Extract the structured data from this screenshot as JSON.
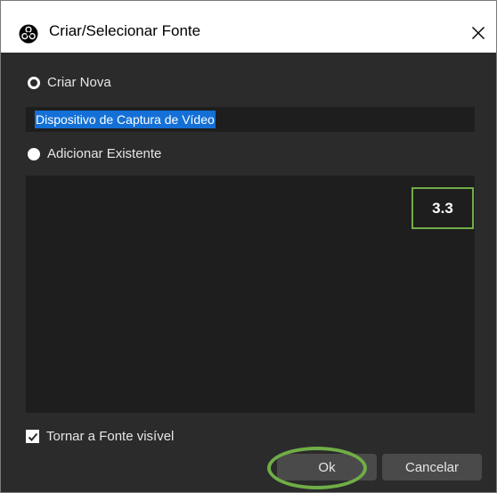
{
  "dialog": {
    "title": "Criar/Selecionar Fonte",
    "close_icon": "close-icon"
  },
  "create_new": {
    "label": "Criar Nova",
    "selected": true,
    "name_value": "Dispositivo de Captura de Vídeo"
  },
  "add_existing": {
    "label": "Adicionar Existente",
    "selected": false
  },
  "annotation": {
    "label": "3.3",
    "color": "#70ad47"
  },
  "visible_checkbox": {
    "label": "Tornar a Fonte visível",
    "checked": true
  },
  "buttons": {
    "ok": "Ok",
    "cancel": "Cancelar"
  },
  "colors": {
    "dialog_bg": "#2b2b2b",
    "field_bg": "#1e1e1e",
    "selection": "#1470d6",
    "button_bg": "#4a4a4a",
    "highlight": "#70ad47"
  }
}
